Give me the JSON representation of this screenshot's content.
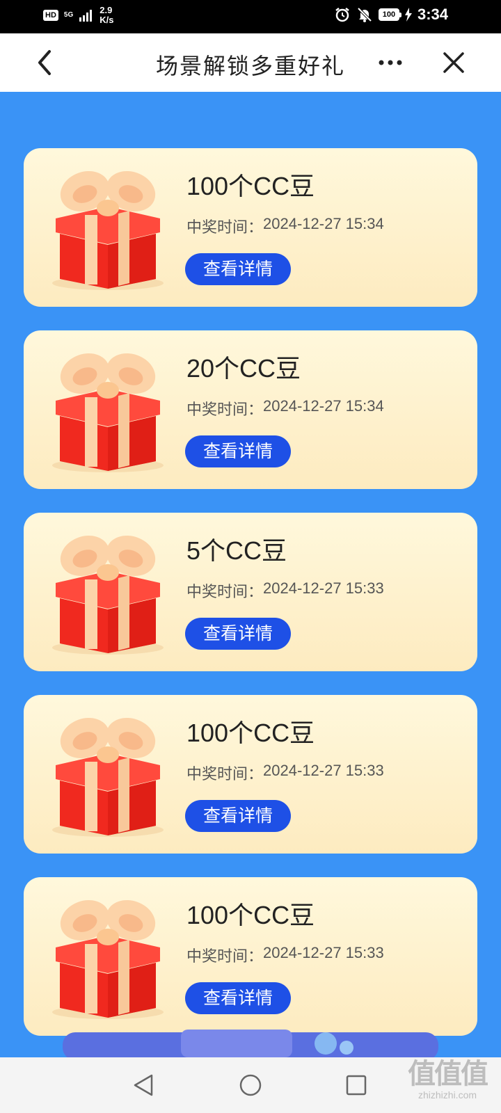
{
  "status_bar": {
    "hd": "HD",
    "network": "5G",
    "speed_value": "2.9",
    "speed_unit": "K/s",
    "battery": "100",
    "time": "3:34"
  },
  "title_bar": {
    "title": "场景解锁多重好礼"
  },
  "rewards": [
    {
      "title": "100个CC豆",
      "time_label": "中奖时间：",
      "time": "2024-12-27 15:34",
      "button": "查看详情"
    },
    {
      "title": "20个CC豆",
      "time_label": "中奖时间：",
      "time": "2024-12-27 15:34",
      "button": "查看详情"
    },
    {
      "title": "5个CC豆",
      "time_label": "中奖时间：",
      "time": "2024-12-27 15:33",
      "button": "查看详情"
    },
    {
      "title": "100个CC豆",
      "time_label": "中奖时间：",
      "time": "2024-12-27 15:33",
      "button": "查看详情"
    },
    {
      "title": "100个CC豆",
      "time_label": "中奖时间：",
      "time": "2024-12-27 15:33",
      "button": "查看详情"
    }
  ],
  "watermark": {
    "glyphs": "值值值",
    "text": "zhizhizhi.com"
  },
  "colors": {
    "background": "#3a93f6",
    "button": "#1e50e6",
    "gift_red": "#f0291f",
    "ribbon": "#fcd3a8"
  }
}
